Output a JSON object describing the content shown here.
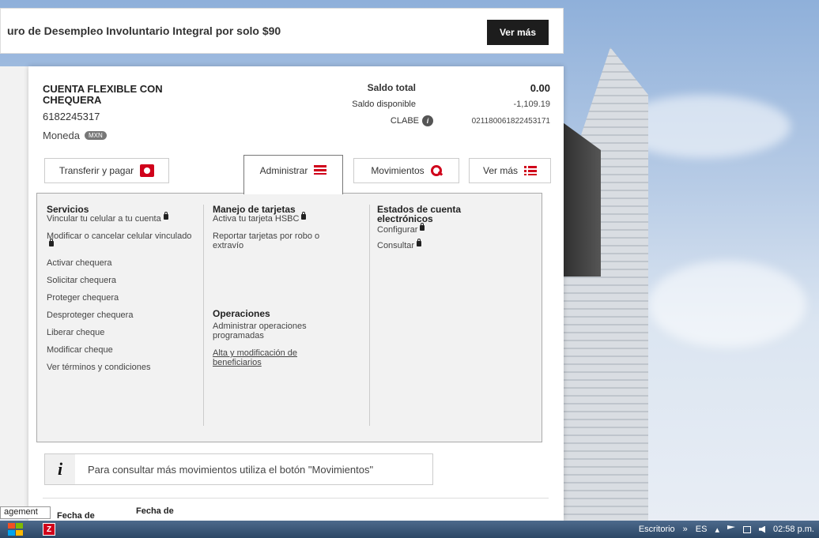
{
  "banner": {
    "text": "uro de Desempleo Involuntario Integral por solo $90",
    "button": "Ver más"
  },
  "account": {
    "title": "CUENTA FLEXIBLE CON CHEQUERA",
    "number": "6182245317",
    "currency_label": "Moneda",
    "currency_badge": "MXN"
  },
  "balances": {
    "total_label": "Saldo total",
    "total_value": "0.00",
    "available_label": "Saldo disponible",
    "available_value": "-1,109.19",
    "clabe_label": "CLABE",
    "clabe_value": "021180061822453171"
  },
  "actions": {
    "transfer": "Transferir y pagar",
    "administrar": "Administrar",
    "movimientos": "Movimientos",
    "ver_mas": "Ver más"
  },
  "admin": {
    "servicios": {
      "title": "Servicios",
      "items": [
        "Vincular tu celular a tu cuenta",
        "Modificar o cancelar celular vinculado",
        "Activar chequera",
        "Solicitar chequera",
        "Proteger chequera",
        "Desproteger chequera",
        "Liberar cheque",
        "Modificar cheque",
        "Ver términos y condiciones"
      ]
    },
    "tarjetas": {
      "title": "Manejo de tarjetas",
      "items": [
        "Activa tu tarjeta HSBC",
        "Reportar tarjetas por robo o extravío"
      ]
    },
    "operaciones": {
      "title": "Operaciones",
      "items": [
        "Administrar operaciones programadas",
        "Alta y modificación de beneficiarios"
      ]
    },
    "estados": {
      "title": "Estados de cuenta electrónicos",
      "items": [
        "Configurar",
        "Consultar"
      ]
    }
  },
  "note": {
    "icon": "i",
    "text": "Para consultar más movimientos utiliza el botón \"Movimientos\""
  },
  "table": {
    "col1": "Fecha de",
    "col2": "Fecha de"
  },
  "tooltip": "agement",
  "taskbar": {
    "desktop": "Escritorio",
    "chevron": "»",
    "lang": "ES",
    "time": "02:58 p.m."
  }
}
